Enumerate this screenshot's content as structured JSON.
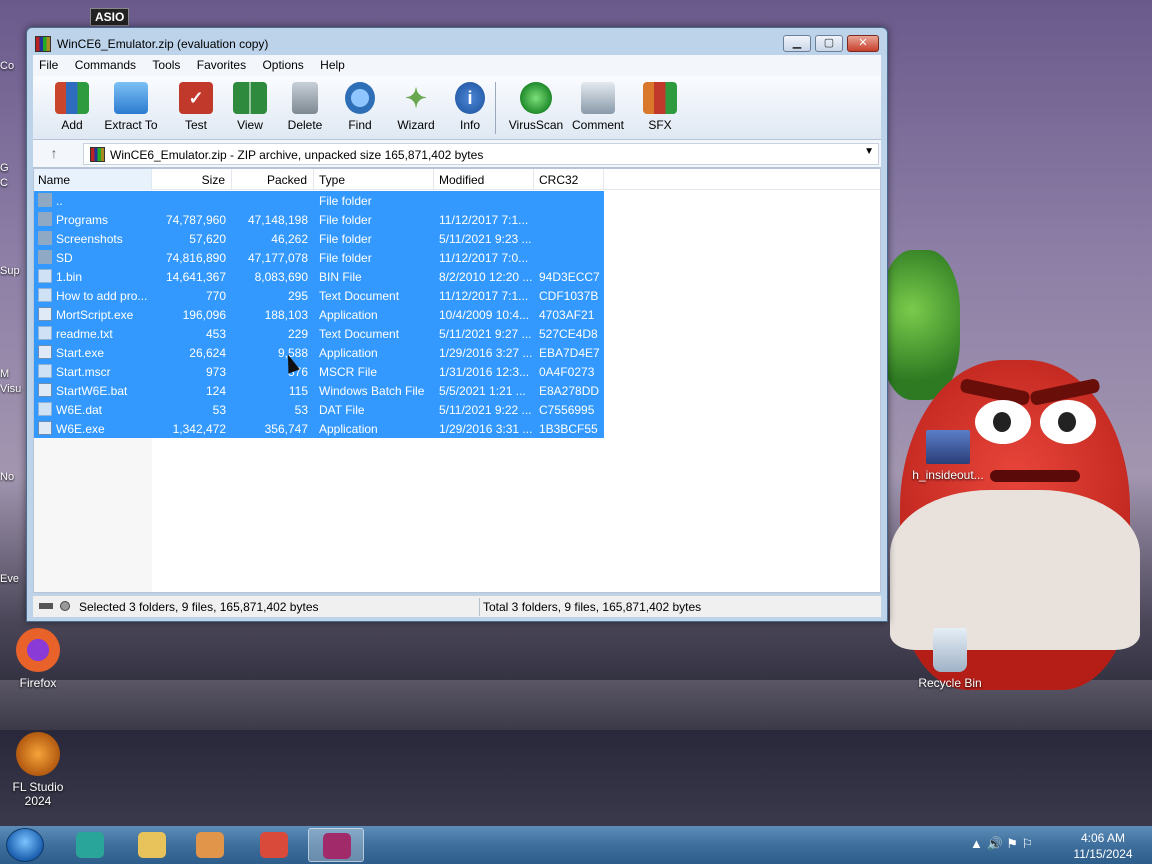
{
  "window": {
    "title": "WinCE6_Emulator.zip (evaluation copy)",
    "controls": {
      "minimize": "▁",
      "maximize": "▢",
      "close": "✕"
    }
  },
  "menu": [
    "File",
    "Commands",
    "Tools",
    "Favorites",
    "Options",
    "Help"
  ],
  "toolbar": [
    {
      "label": "Add",
      "icon": "add-archive-icon",
      "color": "#c9462c"
    },
    {
      "label": "Extract To",
      "icon": "extract-folder-icon",
      "color": "#3b8bd6"
    },
    {
      "label": "Test",
      "icon": "test-icon",
      "color": "#c0392b"
    },
    {
      "label": "View",
      "icon": "view-book-icon",
      "color": "#2e8b3e"
    },
    {
      "label": "Delete",
      "icon": "trash-icon",
      "color": "#8a949e"
    },
    {
      "label": "Find",
      "icon": "magnifier-icon",
      "color": "#2f6fb8"
    },
    {
      "label": "Wizard",
      "icon": "wand-icon",
      "color": "#6aa84f"
    },
    {
      "label": "Info",
      "icon": "info-icon",
      "color": "#2a62b0"
    },
    {
      "label": "VirusScan",
      "icon": "virus-scan-icon",
      "color": "#2fa33b"
    },
    {
      "label": "Comment",
      "icon": "comment-icon",
      "color": "#8a9aaa"
    },
    {
      "label": "SFX",
      "icon": "sfx-box-icon",
      "color": "#d9772b"
    }
  ],
  "address": {
    "text": "WinCE6_Emulator.zip - ZIP archive, unpacked size 165,871,402 bytes"
  },
  "columns": {
    "name": "Name",
    "size": "Size",
    "packed": "Packed",
    "type": "Type",
    "modified": "Modified",
    "crc": "CRC32"
  },
  "files": [
    {
      "name": "..",
      "size": "",
      "packed": "",
      "type": "File folder",
      "modified": "",
      "crc": "",
      "kind": "folder"
    },
    {
      "name": "Programs",
      "size": "74,787,960",
      "packed": "47,148,198",
      "type": "File folder",
      "modified": "11/12/2017 7:1...",
      "crc": "",
      "kind": "folder"
    },
    {
      "name": "Screenshots",
      "size": "57,620",
      "packed": "46,262",
      "type": "File folder",
      "modified": "5/11/2021 9:23 ...",
      "crc": "",
      "kind": "folder"
    },
    {
      "name": "SD",
      "size": "74,816,890",
      "packed": "47,177,078",
      "type": "File folder",
      "modified": "11/12/2017 7:0...",
      "crc": "",
      "kind": "folder"
    },
    {
      "name": "1.bin",
      "size": "14,641,367",
      "packed": "8,083,690",
      "type": "BIN File",
      "modified": "8/2/2010 12:20 ...",
      "crc": "94D3ECC7",
      "kind": "file"
    },
    {
      "name": "How to add pro...",
      "size": "770",
      "packed": "295",
      "type": "Text Document",
      "modified": "11/12/2017 7:1...",
      "crc": "CDF1037B",
      "kind": "file"
    },
    {
      "name": "MortScript.exe",
      "size": "196,096",
      "packed": "188,103",
      "type": "Application",
      "modified": "10/4/2009 10:4...",
      "crc": "4703AF21",
      "kind": "exe"
    },
    {
      "name": "readme.txt",
      "size": "453",
      "packed": "229",
      "type": "Text Document",
      "modified": "5/11/2021 9:27 ...",
      "crc": "527CE4D8",
      "kind": "file"
    },
    {
      "name": "Start.exe",
      "size": "26,624",
      "packed": "9,588",
      "type": "Application",
      "modified": "1/29/2016 3:27 ...",
      "crc": "EBA7D4E7",
      "kind": "exe"
    },
    {
      "name": "Start.mscr",
      "size": "973",
      "packed": "376",
      "type": "MSCR File",
      "modified": "1/31/2016 12:3...",
      "crc": "0A4F0273",
      "kind": "file"
    },
    {
      "name": "StartW6E.bat",
      "size": "124",
      "packed": "115",
      "type": "Windows Batch File",
      "modified": "5/5/2021 1:21 ...",
      "crc": "E8A278DD",
      "kind": "exe"
    },
    {
      "name": "W6E.dat",
      "size": "53",
      "packed": "53",
      "type": "DAT File",
      "modified": "5/11/2021 9:22 ...",
      "crc": "C7556995",
      "kind": "file"
    },
    {
      "name": "W6E.exe",
      "size": "1,342,472",
      "packed": "356,747",
      "type": "Application",
      "modified": "1/29/2016 3:31 ...",
      "crc": "1B3BCF55",
      "kind": "exe"
    }
  ],
  "status": {
    "selected": "Selected 3 folders, 9 files, 165,871,402 bytes",
    "total": "Total 3 folders, 9 files, 165,871,402 bytes"
  },
  "desktop": {
    "icons": [
      {
        "label": "Firefox",
        "icon": "firefox-icon",
        "color": "#e8622a"
      },
      {
        "label": "FL Studio 2024",
        "icon": "fl-studio-icon",
        "color": "#f08a1c"
      },
      {
        "label": "Recycle Bin",
        "icon": "recycle-bin-icon",
        "color": "#b9c7d6"
      },
      {
        "label": "h_insideout...",
        "icon": "image-file-icon",
        "color": "#3a5a9a"
      }
    ],
    "edge_labels": [
      "Co",
      "G",
      "C",
      "Sup",
      "M",
      "Visu",
      "No",
      "Eve"
    ],
    "asio_label": "ASIO"
  },
  "taskbar": {
    "apps": [
      {
        "name": "taskbar-app-1",
        "icon": "app-icon",
        "color": "#2aa59a"
      },
      {
        "name": "taskbar-explorer",
        "icon": "folder-icon",
        "color": "#e8c25a"
      },
      {
        "name": "taskbar-media",
        "icon": "media-player-icon",
        "color": "#e0954a"
      },
      {
        "name": "taskbar-chrome",
        "icon": "chrome-icon",
        "color": "#d94a3a"
      },
      {
        "name": "taskbar-winrar",
        "icon": "winrar-icon",
        "color": "#a02a6a"
      }
    ],
    "tray": "▲  🔊 ⚑ ⚐",
    "time": "4:06 AM",
    "date": "11/15/2024"
  }
}
